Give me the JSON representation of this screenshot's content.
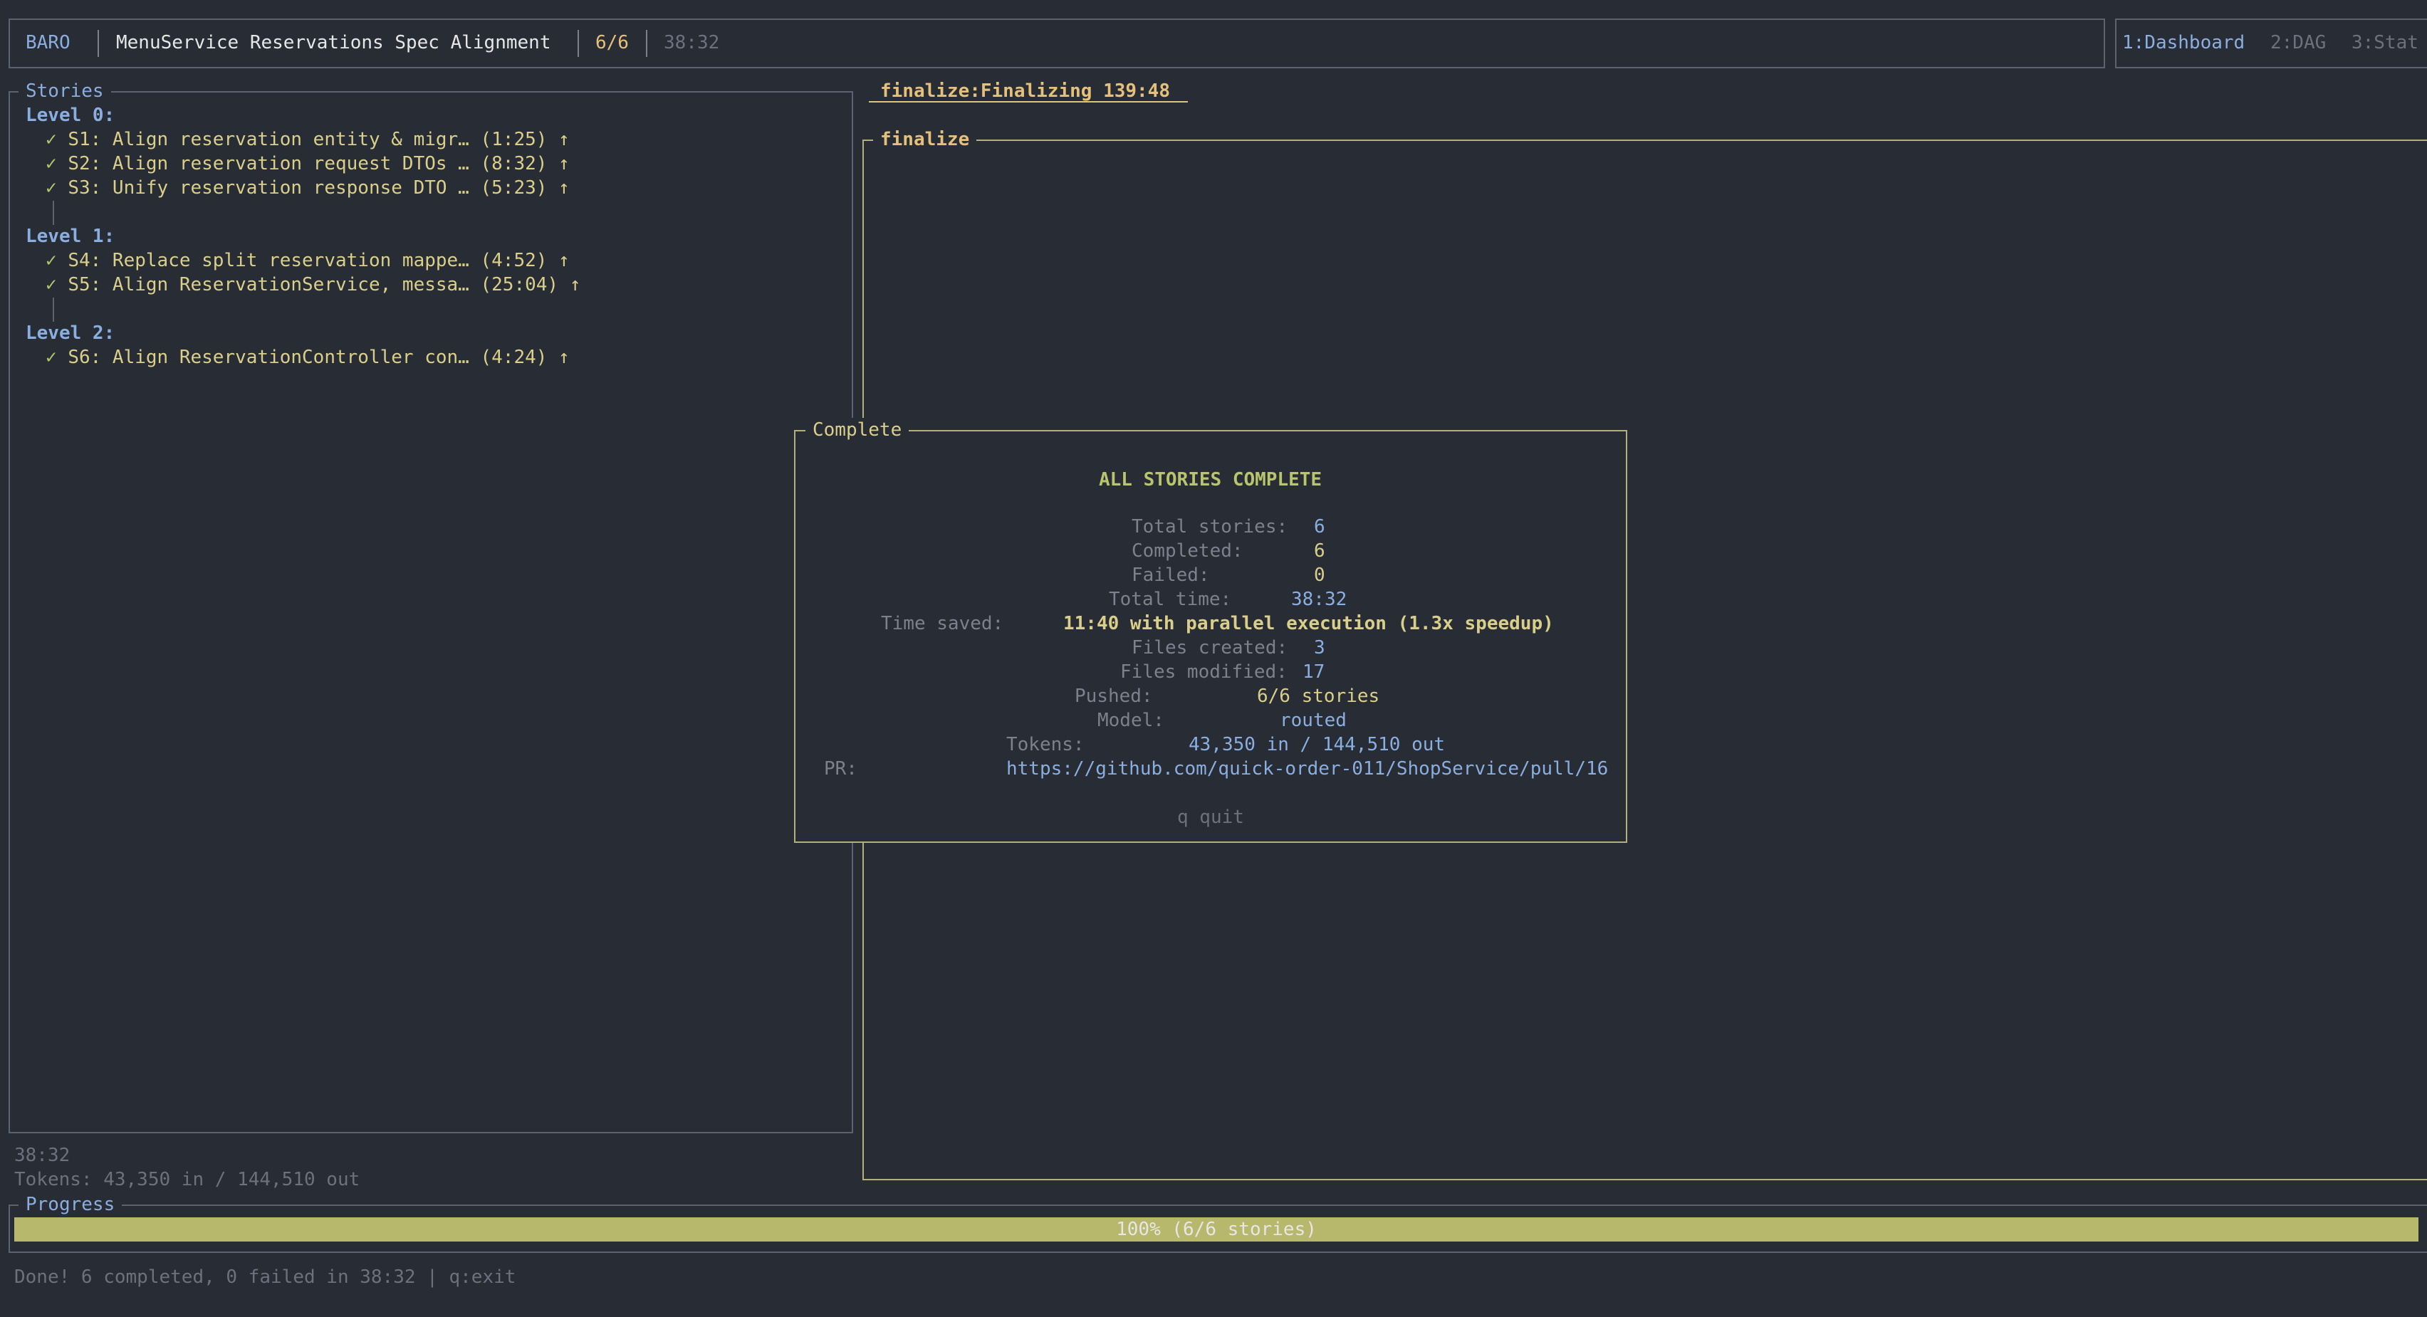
{
  "header": {
    "app": "BARO",
    "project": "MenuService Reservations Spec Alignment",
    "count": "6/6",
    "elapsed": "38:32"
  },
  "tabs": [
    {
      "label": "1:Dashboard",
      "active": true
    },
    {
      "label": "2:DAG",
      "active": false
    },
    {
      "label": "3:Stat",
      "active": false
    }
  ],
  "stories_panel": {
    "title": "Stories",
    "levels": [
      {
        "label": "Level 0:",
        "stories": [
          {
            "mark": "✓",
            "text": "S1: Align reservation entity & migr… (1:25) ↑"
          },
          {
            "mark": "✓",
            "text": "S2: Align reservation request DTOs … (8:32) ↑"
          },
          {
            "mark": "✓",
            "text": "S3: Unify reservation response DTO … (5:23) ↑"
          }
        ]
      },
      {
        "label": "Level 1:",
        "stories": [
          {
            "mark": "✓",
            "text": "S4: Replace split reservation mappe… (4:52) ↑"
          },
          {
            "mark": "✓",
            "text": "S5: Align ReservationService, messa… (25:04) ↑"
          }
        ]
      },
      {
        "label": "Level 2:",
        "stories": [
          {
            "mark": "✓",
            "text": "S6: Align ReservationController con… (4:24) ↑"
          }
        ]
      }
    ]
  },
  "stats": {
    "time": "38:32",
    "tokens": "Tokens: 43,350 in / 144,510 out"
  },
  "active_tab": "finalize:Finalizing 139:48",
  "finalize_panel": {
    "title": "finalize"
  },
  "modal": {
    "title": "Complete",
    "heading": "ALL STORIES COMPLETE",
    "rows": {
      "total_stories": {
        "label": "Total stories:",
        "value": "6"
      },
      "completed": {
        "label": "Completed:",
        "value": "6"
      },
      "failed": {
        "label": "Failed:",
        "value": "0"
      },
      "total_time": {
        "label": "Total time:",
        "value": "38:32"
      },
      "time_saved": {
        "label": "Time saved:",
        "value": "11:40 with parallel execution (1.3x speedup)"
      },
      "files_created": {
        "label": "Files created:",
        "value": "3"
      },
      "files_modified": {
        "label": "Files modified:",
        "value": "17"
      },
      "pushed": {
        "label": "Pushed:",
        "value": "6/6 stories"
      },
      "model": {
        "label": "Model:",
        "value": "routed"
      },
      "tokens": {
        "label": "Tokens:",
        "value": "43,350 in / 144,510 out"
      },
      "pr": {
        "label": "PR:",
        "value": "https://github.com/quick-order-011/ShopService/pull/16"
      }
    },
    "quit_hint": "q quit"
  },
  "progress": {
    "title": "Progress",
    "label": "100% (6/6 stories)",
    "fraction": 1.0
  },
  "status_bar": "Done! 6 completed, 0 failed in 38:32 | q:exit",
  "colors": {
    "background": "#282c34",
    "accent_blue": "#8aaee0",
    "accent_yellow": "#e5c07b",
    "progress_fill": "#b8b86c"
  }
}
